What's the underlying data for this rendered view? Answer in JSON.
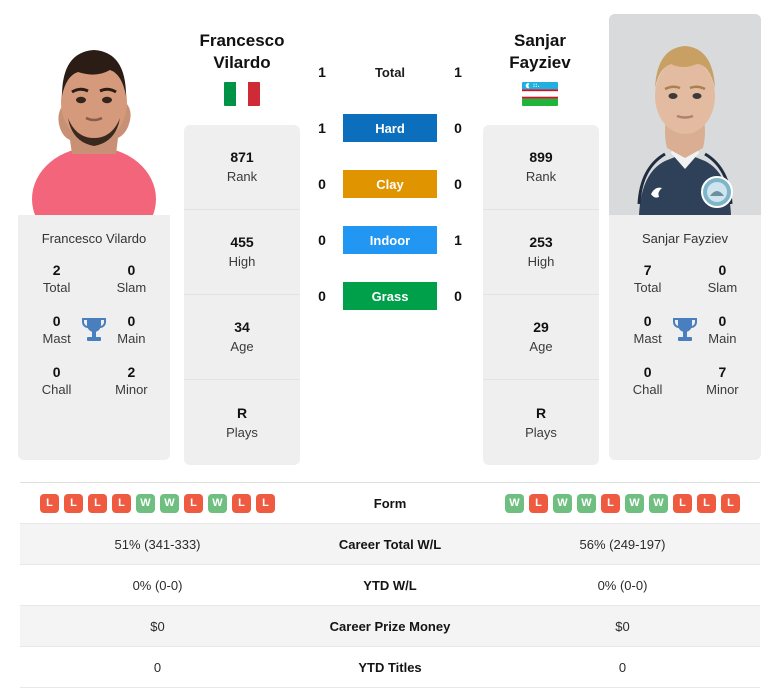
{
  "players": {
    "left": {
      "first_name": "Francesco",
      "last_name": "Vilardo",
      "full_name": "Francesco Vilardo",
      "photo_name": "player-photo-francesco-vilardo",
      "country": "Italy",
      "flag_icon": "flag-italy-icon",
      "stats": [
        {
          "value": "871",
          "label": "Rank"
        },
        {
          "value": "455",
          "label": "High"
        },
        {
          "value": "34",
          "label": "Age"
        },
        {
          "value": "R",
          "label": "Plays"
        }
      ],
      "titles": {
        "total": "2",
        "total_label": "Total",
        "slam": "0",
        "slam_label": "Slam",
        "mast": "0",
        "mast_label": "Mast",
        "main": "0",
        "main_label": "Main",
        "chall": "0",
        "chall_label": "Chall",
        "minor": "2",
        "minor_label": "Minor"
      },
      "form": [
        "L",
        "L",
        "L",
        "L",
        "W",
        "W",
        "L",
        "W",
        "L",
        "L"
      ],
      "career_total_wl": "51% (341-333)",
      "ytd_wl": "0% (0-0)",
      "career_prize_money": "$0",
      "ytd_titles": "0"
    },
    "right": {
      "first_name": "Sanjar",
      "last_name": "Fayziev",
      "full_name": "Sanjar Fayziev",
      "photo_name": "player-photo-sanjar-fayziev",
      "country": "Uzbekistan",
      "flag_icon": "flag-uzbekistan-icon",
      "stats": [
        {
          "value": "899",
          "label": "Rank"
        },
        {
          "value": "253",
          "label": "High"
        },
        {
          "value": "29",
          "label": "Age"
        },
        {
          "value": "R",
          "label": "Plays"
        }
      ],
      "titles": {
        "total": "7",
        "total_label": "Total",
        "slam": "0",
        "slam_label": "Slam",
        "mast": "0",
        "mast_label": "Mast",
        "main": "0",
        "main_label": "Main",
        "chall": "0",
        "chall_label": "Chall",
        "minor": "7",
        "minor_label": "Minor"
      },
      "form": [
        "W",
        "L",
        "W",
        "W",
        "L",
        "W",
        "W",
        "L",
        "L",
        "L"
      ],
      "career_total_wl": "56% (249-197)",
      "ytd_wl": "0% (0-0)",
      "career_prize_money": "$0",
      "ytd_titles": "0"
    }
  },
  "head_to_head": {
    "rows": [
      {
        "label": "Total",
        "left": "1",
        "right": "1",
        "color": "none",
        "badge": false
      },
      {
        "label": "Hard",
        "left": "1",
        "right": "0",
        "color": "#0B6FBE",
        "badge": true
      },
      {
        "label": "Clay",
        "left": "0",
        "right": "0",
        "color": "#E09400",
        "badge": true
      },
      {
        "label": "Indoor",
        "left": "0",
        "right": "1",
        "color": "#2196F3",
        "badge": true
      },
      {
        "label": "Grass",
        "left": "0",
        "right": "0",
        "color": "#00A04B",
        "badge": true
      }
    ]
  },
  "table": {
    "rows": [
      {
        "label": "Form",
        "type": "form"
      },
      {
        "label": "Career Total W/L",
        "type": "text",
        "key": "career_total_wl"
      },
      {
        "label": "YTD W/L",
        "type": "text",
        "key": "ytd_wl"
      },
      {
        "label": "Career Prize Money",
        "type": "text",
        "key": "career_prize_money"
      },
      {
        "label": "YTD Titles",
        "type": "text",
        "key": "ytd_titles"
      }
    ]
  },
  "colors": {
    "hard": "#0B6FBE",
    "clay": "#E09400",
    "indoor": "#2196F3",
    "grass": "#00A04B",
    "win": "#6FC080",
    "loss": "#EF5B40",
    "card_bg": "#efefef",
    "trophy": "#4A7FBF"
  },
  "icons": {
    "trophy": "trophy-icon"
  }
}
